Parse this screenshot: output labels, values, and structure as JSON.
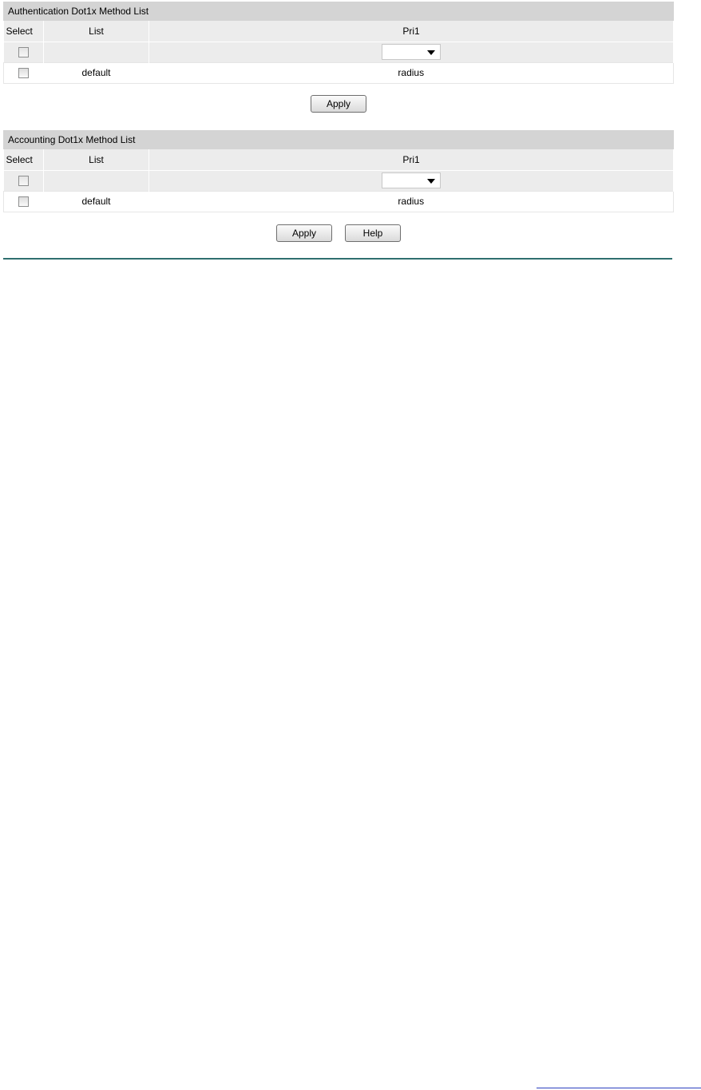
{
  "auth": {
    "title": "Authentication Dot1x Method List",
    "columns": {
      "select": "Select",
      "list": "List",
      "pri1": "Pri1"
    },
    "edit_row": {
      "list_value": "",
      "pri1_selected": ""
    },
    "rows": [
      {
        "list": "default",
        "pri1": "radius"
      }
    ],
    "apply_label": "Apply"
  },
  "acct": {
    "title": "Accounting Dot1x Method List",
    "columns": {
      "select": "Select",
      "list": "List",
      "pri1": "Pri1"
    },
    "edit_row": {
      "list_value": "",
      "pri1_selected": ""
    },
    "rows": [
      {
        "list": "default",
        "pri1": "radius"
      }
    ],
    "apply_label": "Apply",
    "help_label": "Help"
  },
  "icons": {
    "dropdown": "chevron-down-icon",
    "checkbox": "checkbox"
  },
  "colors": {
    "header_bg": "#d4d4d4",
    "row_bg": "#ececec",
    "rule": "#2f6f6f"
  }
}
